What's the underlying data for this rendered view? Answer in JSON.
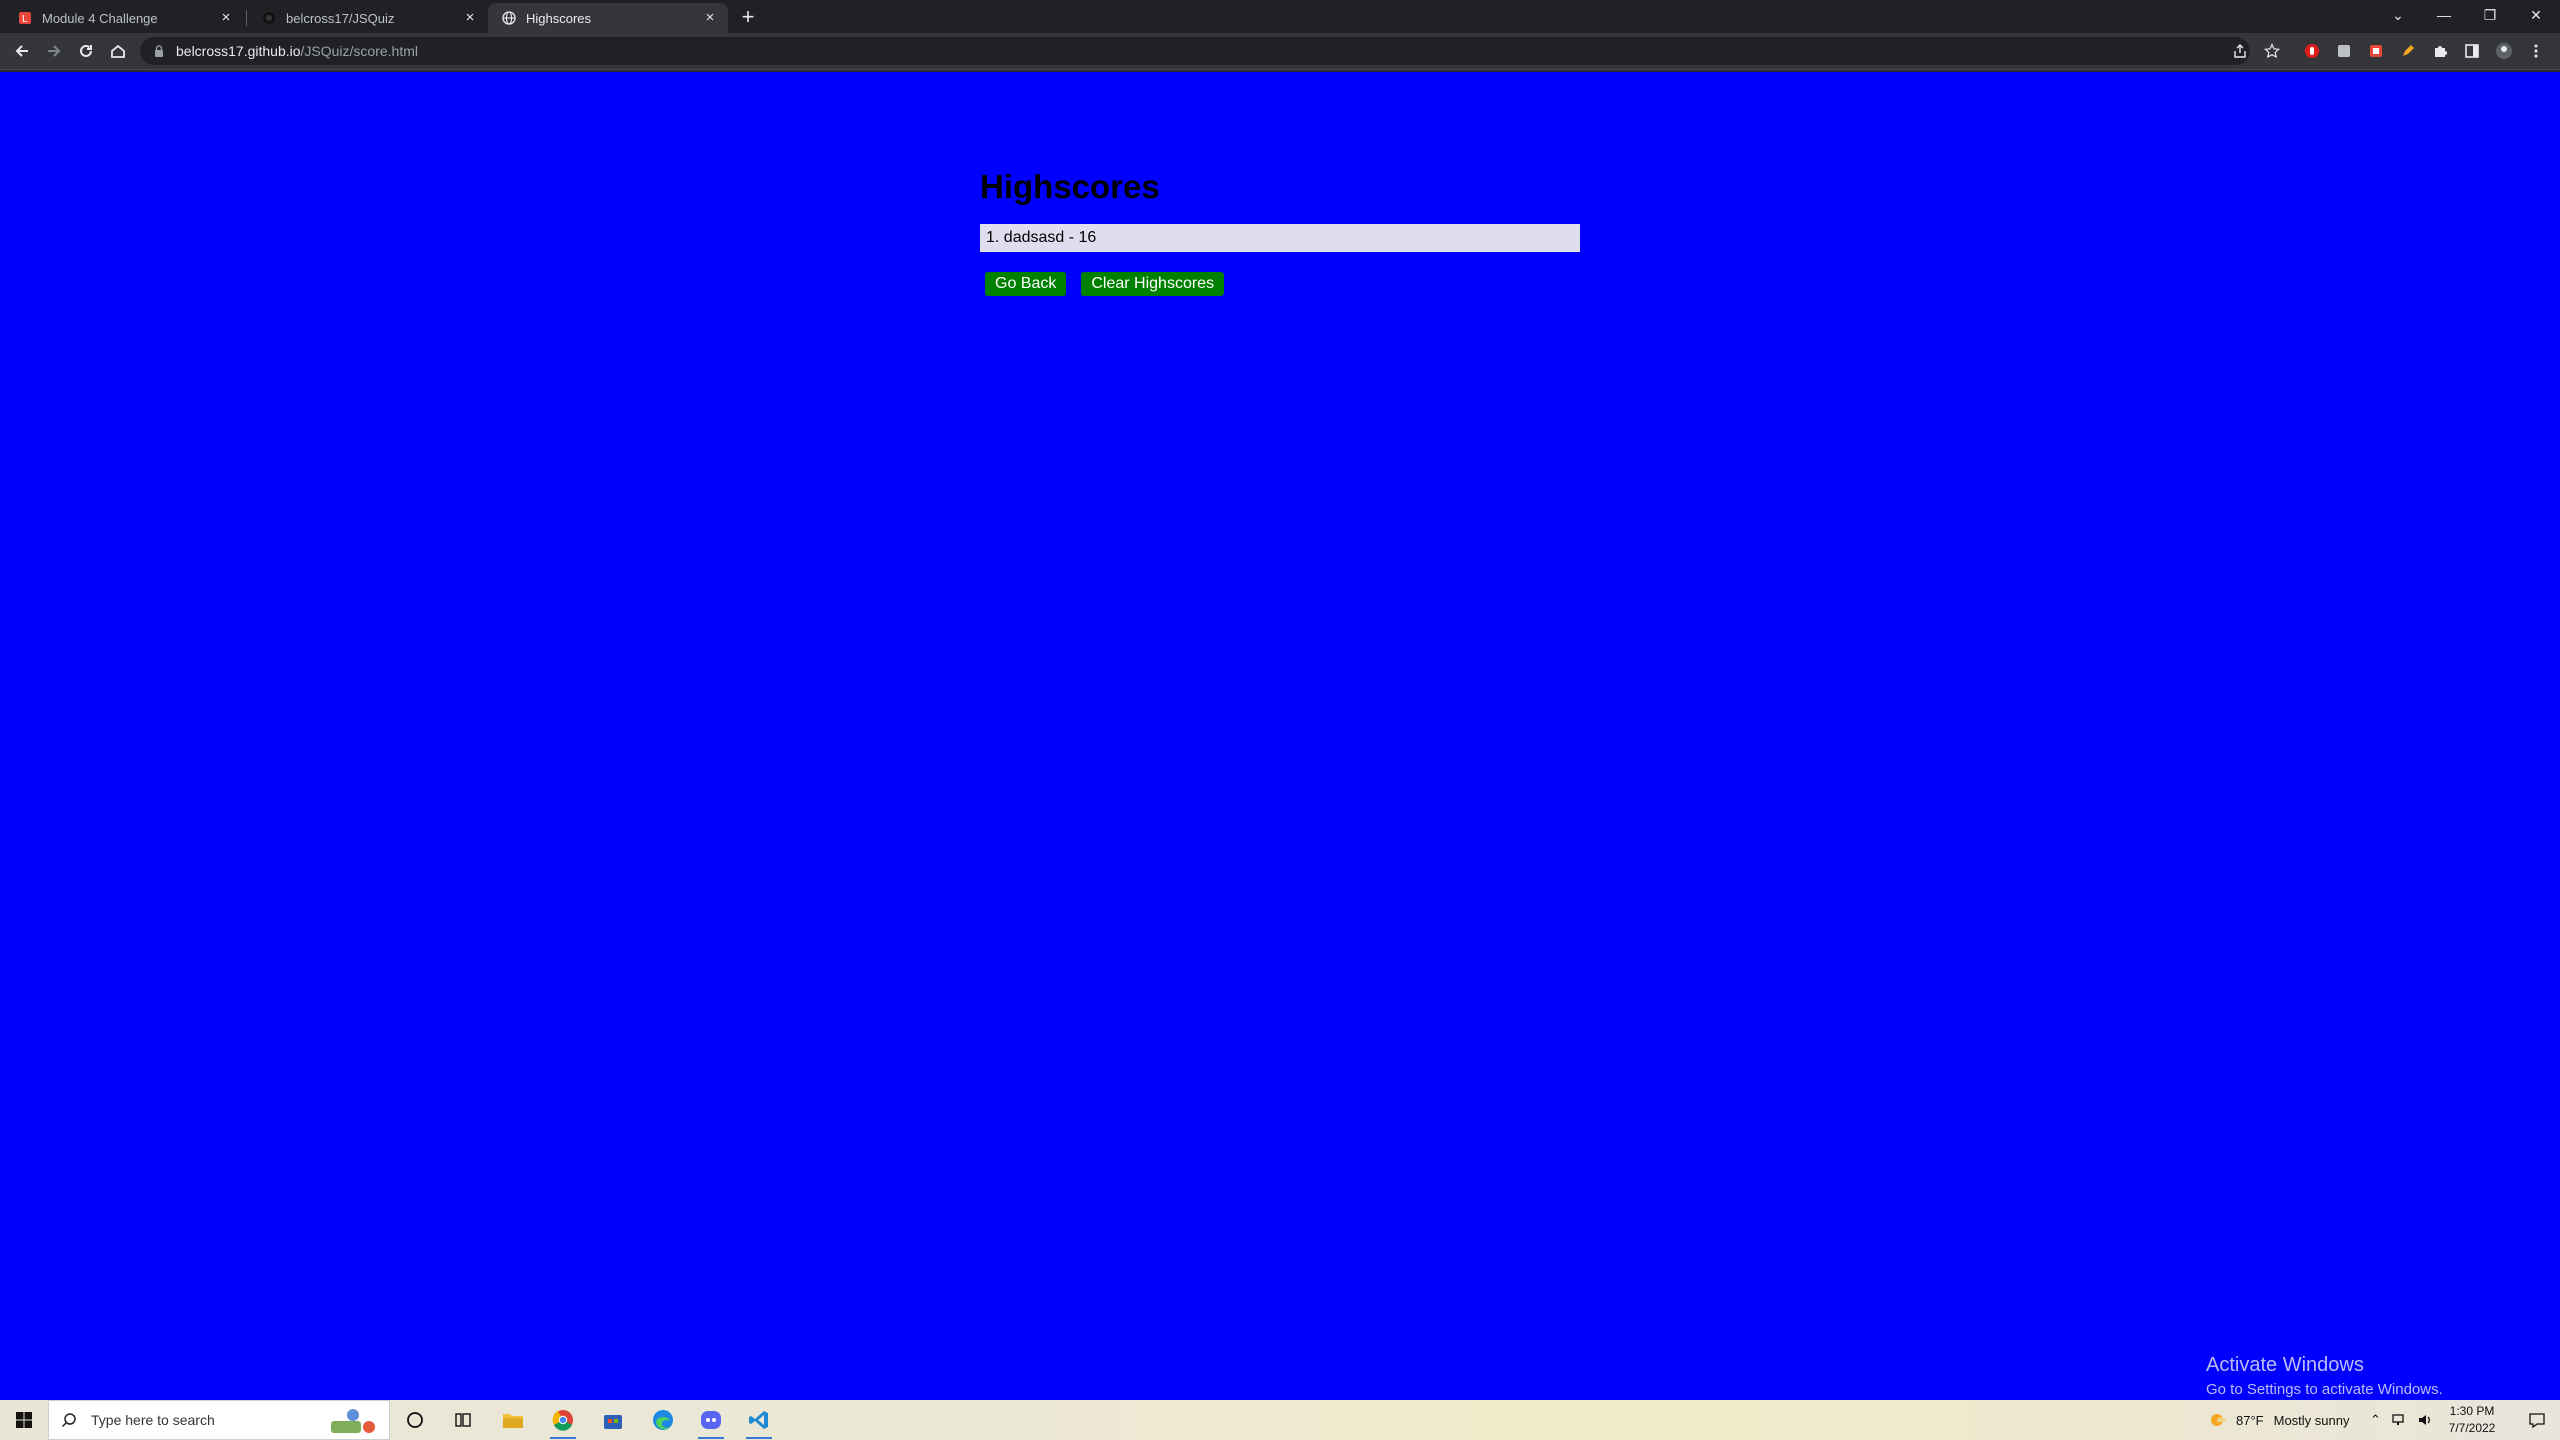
{
  "browser": {
    "tabs": [
      {
        "title": "Module 4 Challenge",
        "active": false
      },
      {
        "title": "belcross17/JSQuiz",
        "active": false
      },
      {
        "title": "Highscores",
        "active": true
      }
    ],
    "url_host": "belcross17.github.io",
    "url_path": "/JSQuiz/score.html"
  },
  "page": {
    "title": "Highscores",
    "scores": [
      "1. dadsasd - 16"
    ],
    "go_back_label": "Go Back",
    "clear_label": "Clear Highscores",
    "background_color": "#0000fe",
    "button_color": "#008000"
  },
  "watermark": {
    "line1": "Activate Windows",
    "line2": "Go to Settings to activate Windows."
  },
  "taskbar": {
    "search_placeholder": "Type here to search",
    "weather_temp": "87°F",
    "weather_desc": "Mostly sunny",
    "time": "1:30 PM",
    "date": "7/7/2022"
  }
}
